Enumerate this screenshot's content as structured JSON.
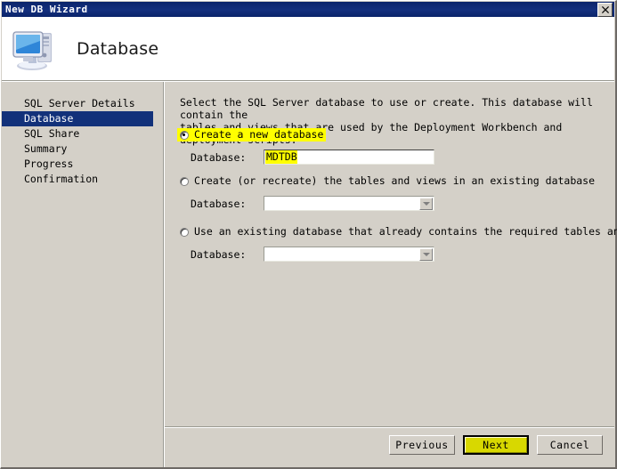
{
  "window": {
    "title": "New DB Wizard",
    "close_label": "✕"
  },
  "header": {
    "title": "Database",
    "icon": "computer-icon"
  },
  "sidebar": {
    "items": [
      {
        "label": "SQL Server Details",
        "selected": false
      },
      {
        "label": "Database",
        "selected": true
      },
      {
        "label": "SQL Share",
        "selected": false
      },
      {
        "label": "Summary",
        "selected": false
      },
      {
        "label": "Progress",
        "selected": false
      },
      {
        "label": "Confirmation",
        "selected": false
      }
    ]
  },
  "content": {
    "intro_line1": "Select the SQL Server database to use or create.  This database will contain the",
    "intro_line2": "tables and views that are used by the Deployment Workbench and deployment scripts.",
    "options": [
      {
        "label": "Create a new database",
        "checked": true,
        "highlighted": true,
        "field_label": "Database:",
        "field_kind": "textbox",
        "field_value": "MDTDB"
      },
      {
        "label": "Create (or recreate) the tables and views in an existing database",
        "checked": false,
        "highlighted": false,
        "field_label": "Database:",
        "field_kind": "combobox",
        "field_value": ""
      },
      {
        "label": "Use an existing database that already contains the required tables and views",
        "checked": false,
        "highlighted": false,
        "field_label": "Database:",
        "field_kind": "combobox",
        "field_value": ""
      }
    ]
  },
  "footer": {
    "previous_label": "Previous",
    "next_label": "Next",
    "cancel_label": "Cancel"
  },
  "colors": {
    "titlebar": "#0a246a",
    "face": "#d4d0c8",
    "selection": "#12317a",
    "highlight": "#ffff00",
    "default_button": "#d8d800"
  }
}
